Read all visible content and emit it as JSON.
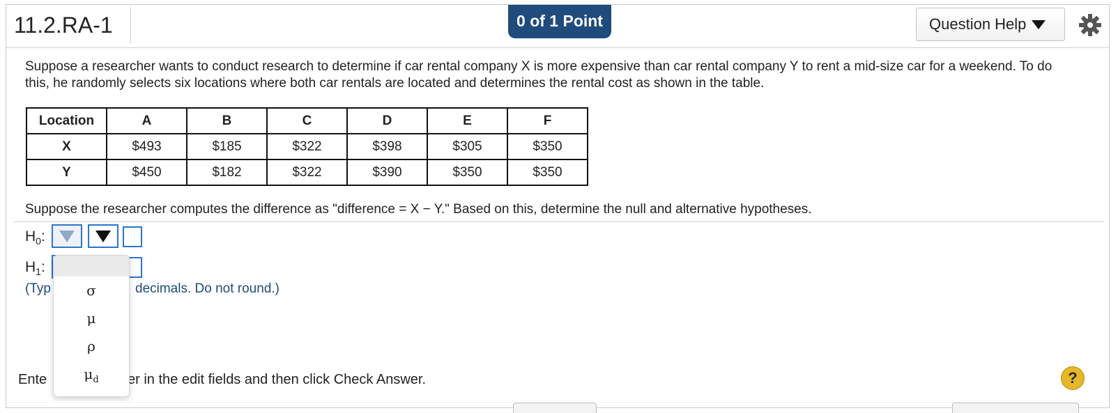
{
  "header": {
    "question_id": "11.2.RA-1",
    "score": "0 of 1 Point",
    "help_label": "Question Help",
    "gear_icon": "gear-icon"
  },
  "intro": "Suppose a researcher wants to conduct research to determine if car rental company X is more expensive than car rental company Y to rent a mid-size car for a weekend. To do this, he randomly selects six locations where both car rentals are located and determines the rental cost as shown in the table.",
  "table": {
    "corner": "Location",
    "columns": [
      "A",
      "B",
      "C",
      "D",
      "E",
      "F"
    ],
    "rows": [
      {
        "label": "X",
        "values": [
          "$493",
          "$185",
          "$322",
          "$398",
          "$305",
          "$350"
        ]
      },
      {
        "label": "Y",
        "values": [
          "$450",
          "$182",
          "$322",
          "$390",
          "$350",
          "$350"
        ]
      }
    ]
  },
  "prompt": "Suppose the researcher computes the difference as \"difference = X − Y.\" Based on this, determine the null and alternative hypotheses.",
  "hypotheses": {
    "h0": {
      "letter": "H",
      "sub": "0",
      "colon": ":"
    },
    "h1": {
      "letter": "H",
      "sub": "1",
      "colon": ":"
    }
  },
  "note": {
    "start": "(Typ",
    "end": "decimals. Do not round.)"
  },
  "dropdown": {
    "options": [
      {
        "symbol": "σ",
        "sub": ""
      },
      {
        "symbol": "μ",
        "sub": ""
      },
      {
        "symbol": "ρ",
        "sub": ""
      },
      {
        "symbol": "μ",
        "sub": "d"
      }
    ]
  },
  "footer": {
    "start": "Ente",
    "end": "er in the edit fields and then click Check Answer.",
    "help_icon": "?"
  }
}
